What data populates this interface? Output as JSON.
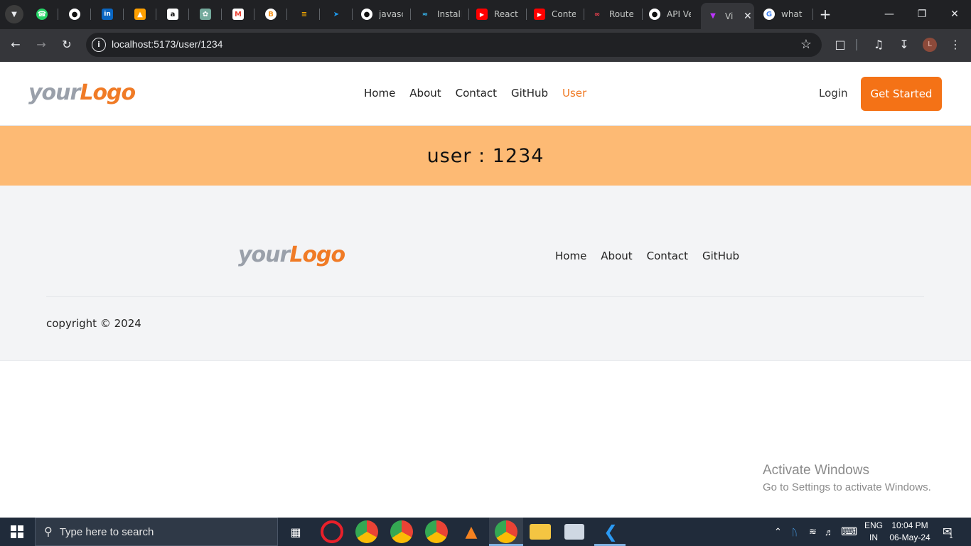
{
  "browser": {
    "tabs": [
      {
        "title": "",
        "icon": "whatsapp-icon",
        "color": "#25d366"
      },
      {
        "title": "",
        "icon": "github-icon",
        "color": "#ffffff"
      },
      {
        "title": "",
        "icon": "linkedin-icon",
        "color": "#0a66c2"
      },
      {
        "title": "",
        "icon": "firebase-icon",
        "color": "#ffa000"
      },
      {
        "title": "",
        "icon": "amazon-icon",
        "color": "#ffffff"
      },
      {
        "title": "",
        "icon": "chatgpt-icon",
        "color": "#74aa9c"
      },
      {
        "title": "",
        "icon": "gmail-icon",
        "color": "#ea4335"
      },
      {
        "title": "",
        "icon": "bitcoin-icon",
        "color": "#f7931a"
      },
      {
        "title": "",
        "icon": "tools-icon",
        "color": "#f0a500"
      },
      {
        "title": "",
        "icon": "bird-icon",
        "color": "#1d9bf0"
      },
      {
        "title": "javasc",
        "icon": "github-icon",
        "color": "#ffffff"
      },
      {
        "title": "Install",
        "icon": "tailwind-icon",
        "color": "#38bdf8"
      },
      {
        "title": "React",
        "icon": "youtube-icon",
        "color": "#ff0000"
      },
      {
        "title": "Conte",
        "icon": "youtube-icon",
        "color": "#ff0000"
      },
      {
        "title": "Router",
        "icon": "router-icon",
        "color": "#f44250"
      },
      {
        "title": "API Ve",
        "icon": "github-icon",
        "color": "#ffffff"
      },
      {
        "title": "Vi",
        "icon": "vite-icon",
        "color": "#bd34fe",
        "active": true
      },
      {
        "title": "what i",
        "icon": "google-icon",
        "color": "#4285f4"
      }
    ],
    "url": "localhost:5173/user/1234",
    "profile_initial": "L"
  },
  "header": {
    "logo_part1": "your",
    "logo_part2": "Logo",
    "nav": [
      "Home",
      "About",
      "Contact",
      "GitHub",
      "User"
    ],
    "active_nav": "User",
    "login": "Login",
    "cta": "Get Started"
  },
  "banner": {
    "text": "user : 1234"
  },
  "footer": {
    "logo_part1": "your",
    "logo_part2": "Logo",
    "nav": [
      "Home",
      "About",
      "Contact",
      "GitHub"
    ],
    "copyright": "copyright © 2024"
  },
  "watermark": {
    "line1": "Activate Windows",
    "line2": "Go to Settings to activate Windows."
  },
  "taskbar": {
    "search_placeholder": "Type here to search",
    "lang1": "ENG",
    "lang2": "IN",
    "time": "10:04 PM",
    "date": "06-May-24",
    "notifications": "1"
  },
  "colors": {
    "accent": "#f47216",
    "banner": "#fdba74",
    "footer_bg": "#f3f4f6"
  }
}
